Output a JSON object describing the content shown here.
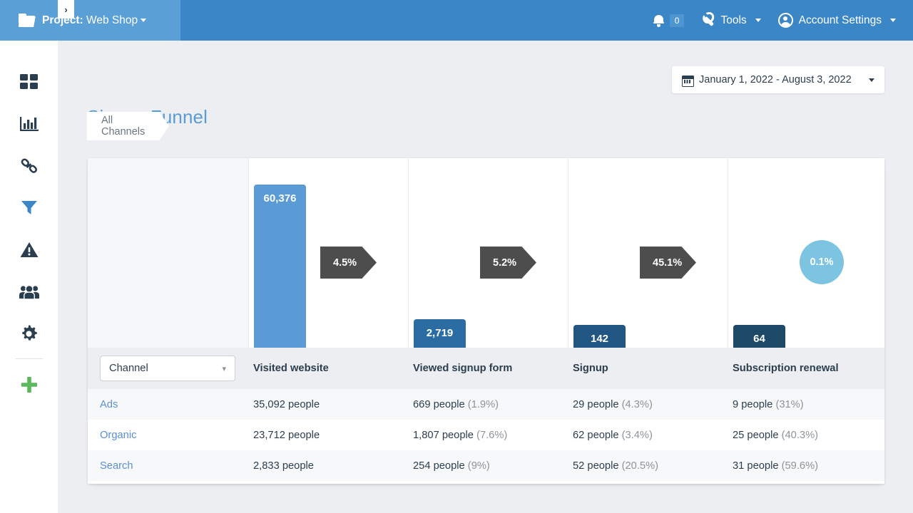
{
  "topbar": {
    "project_prefix": "Project:",
    "project_name": "Web Shop",
    "folder_icon": "folder-icon",
    "notifications": {
      "icon": "bell-icon",
      "count": "0"
    },
    "tools": {
      "icon": "wrench-icon",
      "label": "Tools"
    },
    "account": {
      "icon": "avatar-icon",
      "label": "Account Settings"
    }
  },
  "sidebar": {
    "collapse_icon": "chevron-right-icon",
    "items": [
      {
        "name": "dashboard",
        "icon": "grid-icon",
        "active": false
      },
      {
        "name": "reports",
        "icon": "bar-chart-icon",
        "active": false
      },
      {
        "name": "links",
        "icon": "link-icon",
        "active": false
      },
      {
        "name": "funnels",
        "icon": "funnel-icon",
        "active": true
      },
      {
        "name": "alerts",
        "icon": "warning-triangle-icon",
        "active": false
      },
      {
        "name": "audience",
        "icon": "people-icon",
        "active": false
      },
      {
        "name": "settings",
        "icon": "gear-icon",
        "active": false
      },
      {
        "name": "add",
        "icon": "plus-icon",
        "active": false
      }
    ]
  },
  "page": {
    "title": "Signup Funnel",
    "date_range": "January 1, 2022 - August 3, 2022",
    "calendar_icon": "calendar-icon",
    "tab": "All Channels"
  },
  "chart_data": {
    "type": "bar",
    "title": "Signup Funnel",
    "categories": [
      "Visited website",
      "Viewed signup form",
      "Signup",
      "Subscription renewal"
    ],
    "values": [
      60376,
      2719,
      142,
      64
    ],
    "value_labels": [
      "60,376",
      "2,719",
      "142",
      "64"
    ],
    "conversion_labels": [
      "4.5%",
      "5.2%",
      "45.1%",
      "0.1%"
    ],
    "conversion_kinds": [
      "arrow",
      "arrow",
      "arrow",
      "circle"
    ],
    "bar_colors": [
      "#5b9bd5",
      "#2b6ca3",
      "#225682",
      "#1d4866"
    ],
    "circle_color": "#7cc4e2",
    "arrow_color": "#4d4d4d",
    "grid": false,
    "legend": "none",
    "xlabel": "",
    "ylabel": ""
  },
  "table": {
    "selector_label": "Channel",
    "selector_icon": "chevron-down-icon",
    "headers": [
      "Visited website",
      "Viewed signup form",
      "Signup",
      "Subscription renewal"
    ],
    "rows": [
      {
        "channel": "Ads",
        "visited": "35,092 people",
        "viewed": "669 people",
        "viewed_pct": "(1.9%)",
        "signup": "29 people",
        "signup_pct": "(4.3%)",
        "renewal": "9 people",
        "renewal_pct": "(31%)"
      },
      {
        "channel": "Organic",
        "visited": "23,712 people",
        "viewed": "1,807 people",
        "viewed_pct": "(7.6%)",
        "signup": "62 people",
        "signup_pct": "(3.4%)",
        "renewal": "25 people",
        "renewal_pct": "(40.3%)"
      },
      {
        "channel": "Search",
        "visited": "2,833 people",
        "viewed": "254 people",
        "viewed_pct": "(9%)",
        "signup": "52 people",
        "signup_pct": "(20.5%)",
        "renewal": "31 people",
        "renewal_pct": "(59.6%)"
      }
    ]
  },
  "colors": {
    "brand": "#3b86c6",
    "brand_light": "#5a9fd6",
    "title": "#5b9bd5",
    "page_bg": "#eceef1",
    "link": "#5b8fd4",
    "accent_green": "#5cb85c",
    "dark": "#2b3e50"
  }
}
